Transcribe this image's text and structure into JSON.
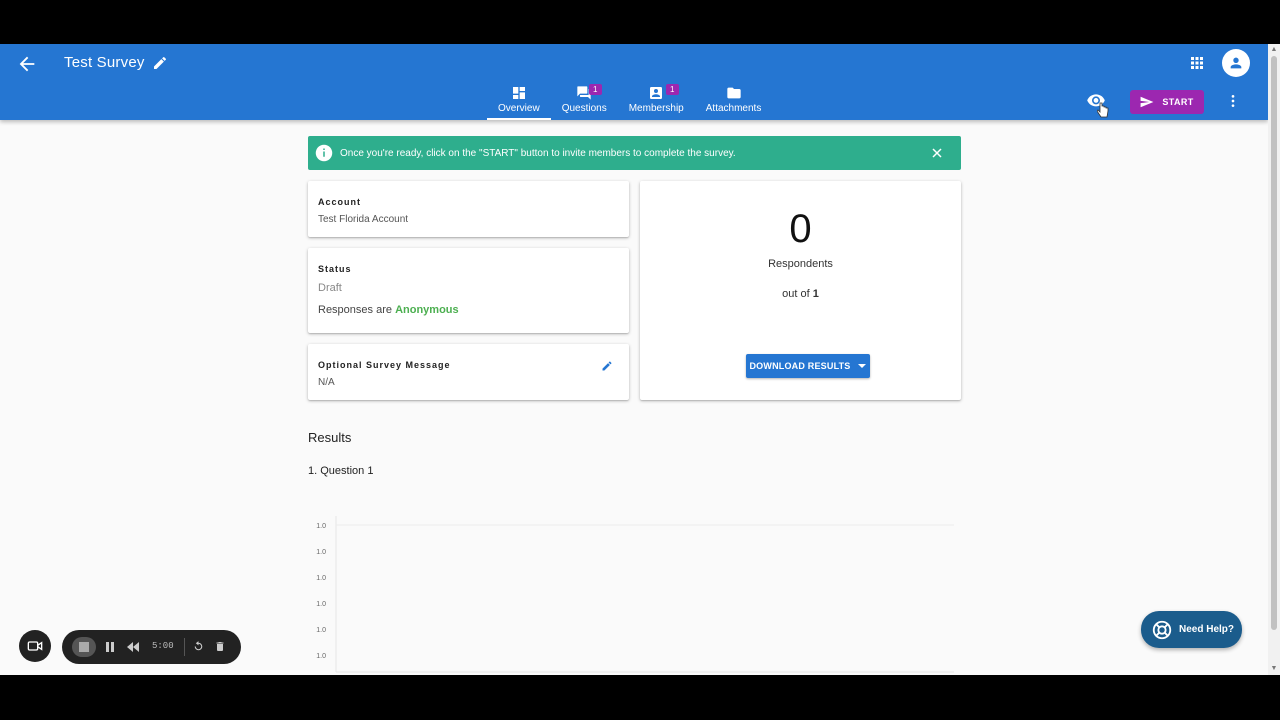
{
  "header": {
    "title": "Test Survey",
    "tabs": [
      {
        "label": "Overview",
        "icon": "dashboard-icon",
        "badge": null,
        "active": true
      },
      {
        "label": "Questions",
        "icon": "forum-icon",
        "badge": "1",
        "active": false
      },
      {
        "label": "Membership",
        "icon": "contact-icon",
        "badge": "1",
        "active": false
      },
      {
        "label": "Attachments",
        "icon": "folder-icon",
        "badge": null,
        "active": false
      }
    ],
    "start_label": "START"
  },
  "banner": {
    "text": "Once you're ready, click on the \"START\" button to invite members to complete the survey."
  },
  "account": {
    "label": "Account",
    "value": "Test Florida Account"
  },
  "status": {
    "label": "Status",
    "value": "Draft",
    "responses_prefix": "Responses are",
    "responses_value": "Anonymous"
  },
  "message": {
    "label": "Optional Survey Message",
    "value": "N/A"
  },
  "respondents": {
    "count": "0",
    "label": "Respondents",
    "out_of_prefix": "out of",
    "out_of_value": "1",
    "download_label": "DOWNLOAD RESULTS"
  },
  "results": {
    "title": "Results",
    "question": "1. Question 1"
  },
  "chart_data": {
    "type": "bar",
    "title": "",
    "yticks": [
      "1.0",
      "1.0",
      "1.0",
      "1.0",
      "1.0",
      "1.0"
    ],
    "categories": [],
    "values": []
  },
  "recorder": {
    "time": "5:00"
  },
  "help": {
    "label": "Need Help?"
  },
  "colors": {
    "primary": "#2576d2",
    "accent": "#9c27b0",
    "banner": "#2eae8d",
    "anonymous": "#4caf50"
  }
}
